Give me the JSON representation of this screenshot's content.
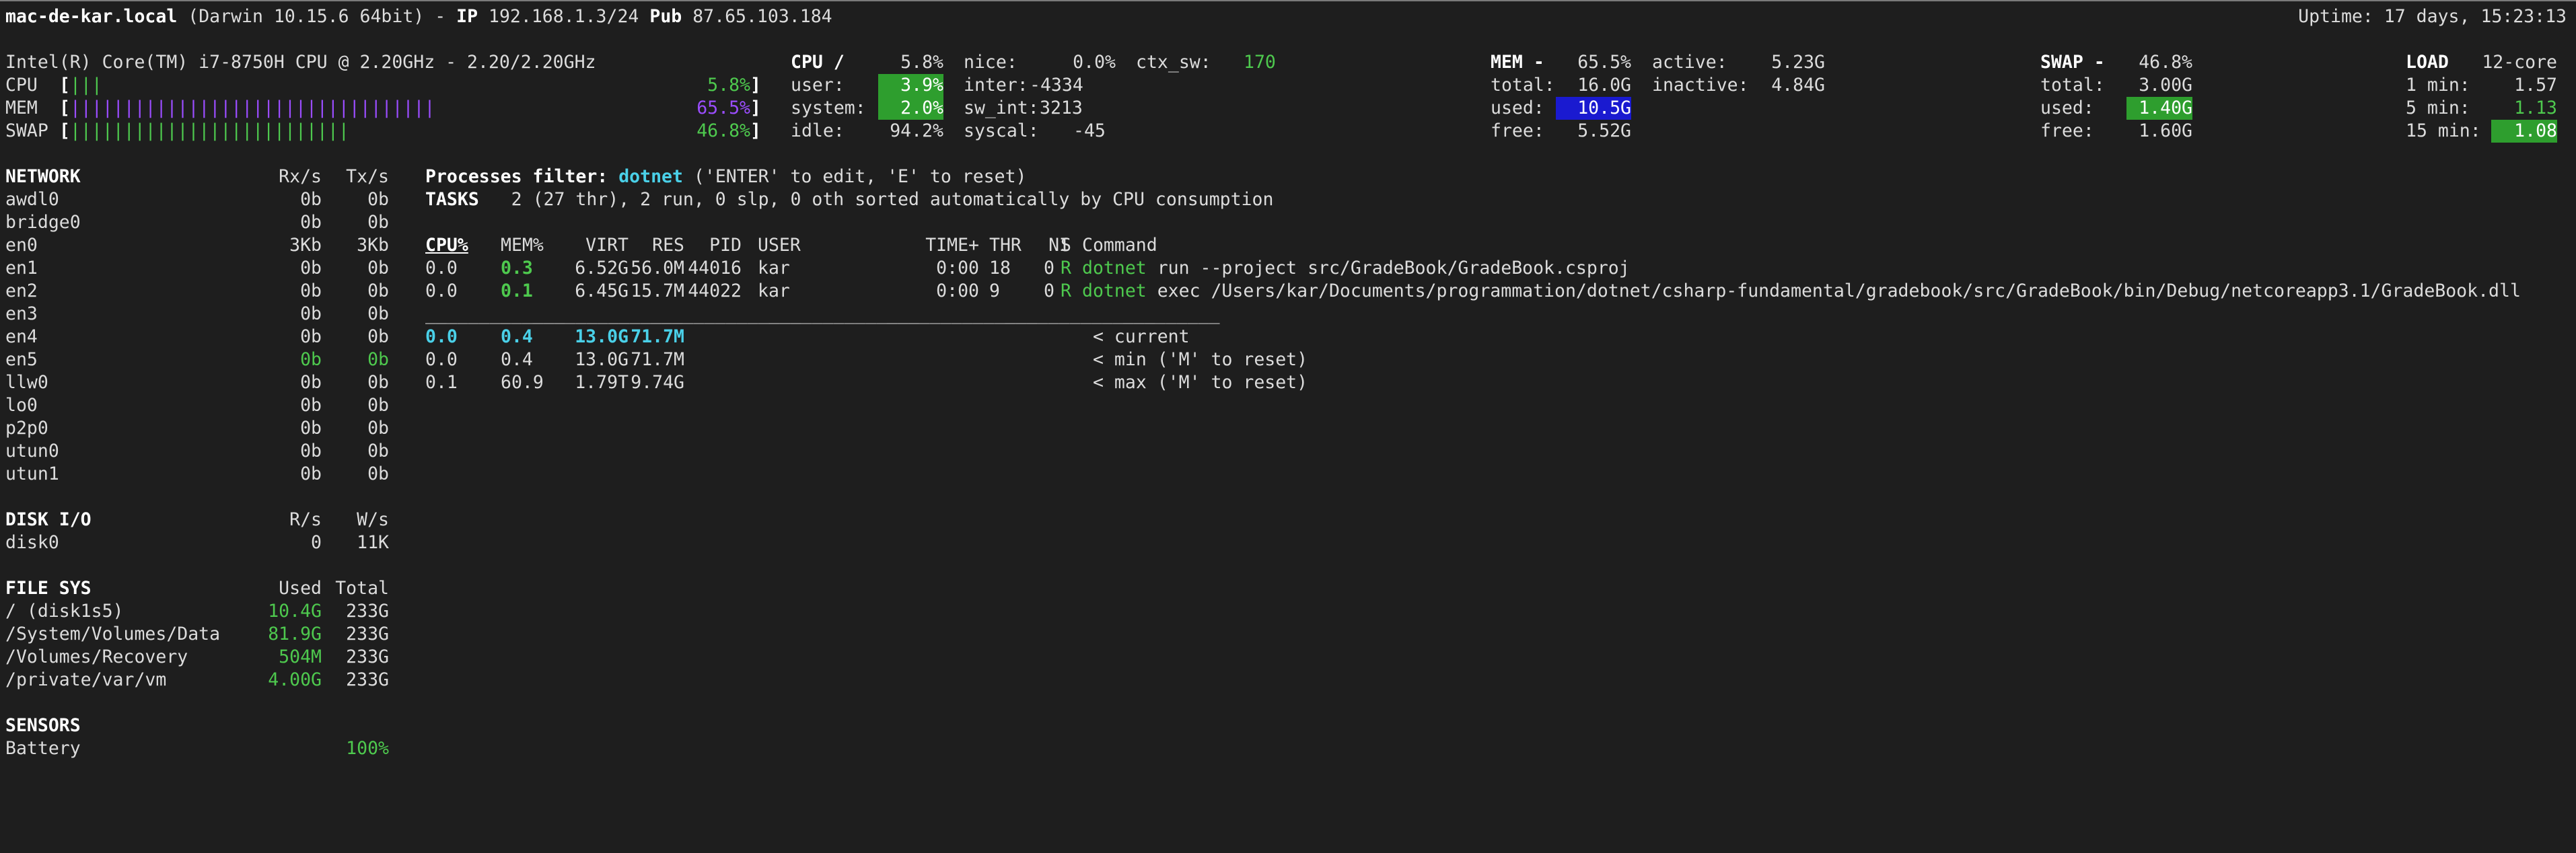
{
  "header": {
    "host": "mac-de-kar.local",
    "os": "(Darwin 10.15.6 64bit)",
    "ip_label": "IP",
    "ip": "192.168.1.3/24",
    "pub_label": "Pub",
    "pub": "87.65.103.184",
    "uptime": "Uptime: 17 days, 15:23:13"
  },
  "quicklook": {
    "cpu_name": "Intel(R) Core(TM) i7-8750H CPU @ 2.20GHz - 2.20/2.20GHz",
    "cpu_label": "CPU",
    "cpu_bar": "|||",
    "cpu_pct": "5.8%",
    "mem_label": "MEM",
    "mem_bar": "||||||||||||||||||||||||||||||||||",
    "mem_pct": "65.5%",
    "swap_label": "SWAP",
    "swap_bar": "||||||||||||||||||||||||||",
    "swap_pct": "46.8%"
  },
  "cpu": {
    "title": "CPU /",
    "total": "5.8%",
    "user_label": "user:",
    "user": "3.9%",
    "system_label": "system:",
    "system": "2.0%",
    "idle_label": "idle:",
    "idle": "94.2%",
    "nice_label": "nice:",
    "nice": "0.0%",
    "inter_label": "inter:",
    "inter": "-4334",
    "swint_label": "sw_int:",
    "swint": "3213",
    "syscal_label": "syscal:",
    "syscal": "-45",
    "ctxsw_label": "ctx_sw:",
    "ctxsw": "170"
  },
  "mem": {
    "title": "MEM -",
    "pct": "65.5%",
    "total_label": "total:",
    "total": "16.0G",
    "used_label": "used:",
    "used": "10.5G",
    "free_label": "free:",
    "free": "5.52G",
    "active_label": "active:",
    "active": "5.23G",
    "inactive_label": "inactive:",
    "inactive": "4.84G"
  },
  "swap": {
    "title": "SWAP -",
    "pct": "46.8%",
    "total_label": "total:",
    "total": "3.00G",
    "used_label": "used:",
    "used": "1.40G",
    "free_label": "free:",
    "free": "1.60G"
  },
  "load": {
    "title": "LOAD",
    "cores": "12-core",
    "m1_label": "1 min:",
    "m1": "1.57",
    "m5_label": "5 min:",
    "m5": "1.13",
    "m15_label": "15 min:",
    "m15": "1.08"
  },
  "network": {
    "title": "NETWORK",
    "rx_h": "Rx/s",
    "tx_h": "Tx/s",
    "rows": [
      {
        "name": "awdl0",
        "rx": "0b",
        "tx": "0b"
      },
      {
        "name": "bridge0",
        "rx": "0b",
        "tx": "0b"
      },
      {
        "name": "en0",
        "rx": "3Kb",
        "tx": "3Kb"
      },
      {
        "name": "en1",
        "rx": "0b",
        "tx": "0b"
      },
      {
        "name": "en2",
        "rx": "0b",
        "tx": "0b"
      },
      {
        "name": "en3",
        "rx": "0b",
        "tx": "0b"
      },
      {
        "name": "en4",
        "rx": "0b",
        "tx": "0b"
      },
      {
        "name": "en5",
        "rx": "0b",
        "tx": "0b"
      },
      {
        "name": "llw0",
        "rx": "0b",
        "tx": "0b"
      },
      {
        "name": "lo0",
        "rx": "0b",
        "tx": "0b"
      },
      {
        "name": "p2p0",
        "rx": "0b",
        "tx": "0b"
      },
      {
        "name": "utun0",
        "rx": "0b",
        "tx": "0b"
      },
      {
        "name": "utun1",
        "rx": "0b",
        "tx": "0b"
      }
    ]
  },
  "diskio": {
    "title": "DISK I/O",
    "r_h": "R/s",
    "w_h": "W/s",
    "rows": [
      {
        "name": "disk0",
        "r": "0",
        "w": "11K"
      }
    ]
  },
  "fs": {
    "title": "FILE SYS",
    "used_h": "Used",
    "total_h": "Total",
    "rows": [
      {
        "name": "/ (disk1s5)",
        "used": "10.4G",
        "total": "233G"
      },
      {
        "name": "/System/Volumes/Data",
        "used": "81.9G",
        "total": "233G"
      },
      {
        "name": "/Volumes/Recovery",
        "used": "504M",
        "total": "233G"
      },
      {
        "name": "/private/var/vm",
        "used": "4.00G",
        "total": "233G"
      }
    ]
  },
  "sensors": {
    "title": "SENSORS",
    "rows": [
      {
        "name": "Battery",
        "value": "100%"
      }
    ]
  },
  "processes": {
    "filter_label": "Processes filter:",
    "filter_value": "dotnet",
    "filter_hint": "('ENTER' to edit, 'E' to reset)",
    "tasks_label": "TASKS",
    "tasks_text": "2 (27 thr), 2 run, 0 slp, 0 oth sorted automatically by CPU consumption",
    "headers": {
      "cpu": "CPU%",
      "mem": "MEM%",
      "virt": "VIRT",
      "res": "RES",
      "pid": "PID",
      "user": "USER",
      "time": "TIME+",
      "thr": "THR",
      "ni": "NI",
      "s": "S",
      "cmd": "Command"
    },
    "rows": [
      {
        "cpu": "0.0",
        "mem": "0.3",
        "virt": "6.52G",
        "res": "56.0M",
        "pid": "44016",
        "user": "kar",
        "time": "0:00",
        "thr": "18",
        "ni": "0",
        "s": "R",
        "cmd_name": "dotnet",
        "cmd_args": "run --project src/GradeBook/GradeBook.csproj"
      },
      {
        "cpu": "0.0",
        "mem": "0.1",
        "virt": "6.45G",
        "res": "15.7M",
        "pid": "44022",
        "user": "kar",
        "time": "0:00",
        "thr": "9",
        "ni": "0",
        "s": "R",
        "cmd_name": "dotnet",
        "cmd_args": "exec /Users/kar/Documents/programmation/dotnet/csharp-fundamental/gradebook/src/GradeBook/bin/Debug/netcoreapp3.1/GradeBook.dll"
      }
    ],
    "separator": "__________________________________________________________________________",
    "stats": [
      {
        "cpu": "0.0",
        "mem": "0.4",
        "virt": "13.0G",
        "res": "71.7M",
        "label": "< current"
      },
      {
        "cpu": "0.0",
        "mem": "0.4",
        "virt": "13.0G",
        "res": "71.7M",
        "label": "< min ('M' to reset)"
      },
      {
        "cpu": "0.1",
        "mem": "60.9",
        "virt": "1.79T",
        "res": "9.74G",
        "label": "< max ('M' to reset)"
      }
    ]
  }
}
